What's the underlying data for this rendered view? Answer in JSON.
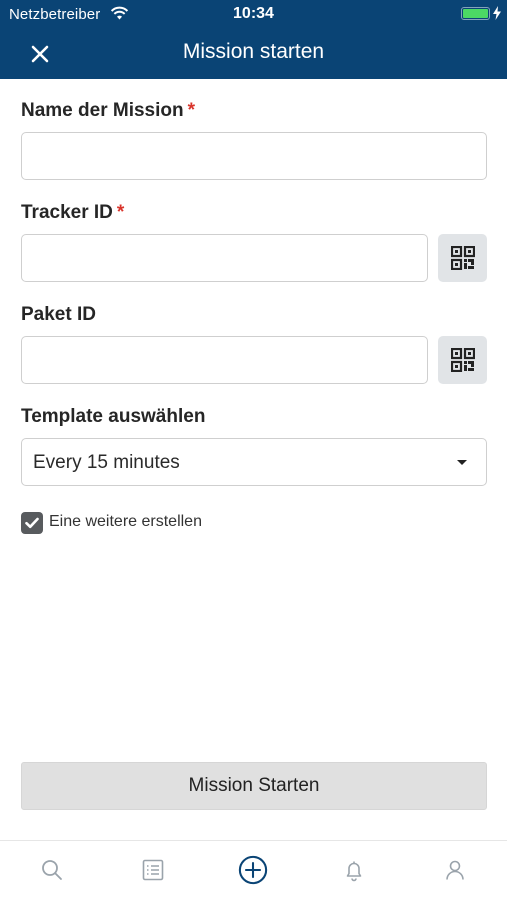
{
  "status_bar": {
    "carrier": "Netzbetreiber",
    "time": "10:34",
    "wifi_icon": "wifi-icon",
    "battery_icon": "battery-icon",
    "battery_level": 1.0
  },
  "header": {
    "title": "Mission starten",
    "close_icon": "close-icon",
    "background_color": "#0a4475"
  },
  "form": {
    "mission_name": {
      "label": "Name der Mission",
      "required_mark": "*",
      "value": ""
    },
    "tracker_id": {
      "label": "Tracker ID",
      "required_mark": "*",
      "value": "",
      "scan_icon": "qr-code-icon"
    },
    "package_id": {
      "label": "Paket ID",
      "value": "",
      "scan_icon": "qr-code-icon"
    },
    "template": {
      "label": "Template auswählen",
      "selected": "Every 15 minutes"
    },
    "create_another": {
      "label": "Eine weitere erstellen",
      "checked": true
    }
  },
  "submit_label": "Mission Starten",
  "tab_bar": {
    "items": [
      {
        "icon": "search-icon"
      },
      {
        "icon": "list-icon"
      },
      {
        "icon": "add-circle-icon",
        "active": true
      },
      {
        "icon": "bell-icon"
      },
      {
        "icon": "user-icon"
      }
    ]
  },
  "colors": {
    "accent": "#0a4475",
    "required": "#d9342b",
    "inactive_icon": "#9aa3ab"
  }
}
